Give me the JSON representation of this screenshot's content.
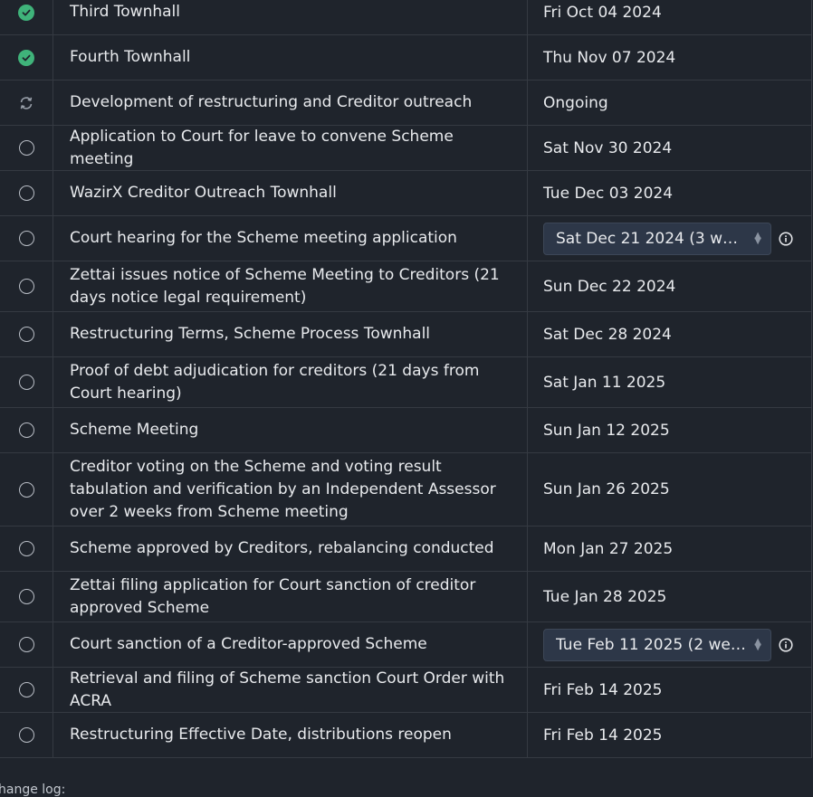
{
  "rows": [
    {
      "status": "done",
      "status_icon": "check-circle-icon",
      "task": "Third Townhall",
      "date": "Fri Oct 04 2024"
    },
    {
      "status": "done",
      "status_icon": "check-circle-icon",
      "task": "Fourth Townhall",
      "date": "Thu Nov 07 2024"
    },
    {
      "status": "ongoing",
      "status_icon": "sync-icon",
      "task": "Development of restructuring and Creditor outreach",
      "date": "Ongoing"
    },
    {
      "status": "todo",
      "status_icon": "empty-circle-icon",
      "task": "Application to Court for leave to convene Scheme meeting",
      "date": "Sat Nov 30 2024"
    },
    {
      "status": "todo",
      "status_icon": "empty-circle-icon",
      "task": "WazirX Creditor Outreach Townhall",
      "date": "Tue Dec 03 2024"
    },
    {
      "status": "todo",
      "status_icon": "empty-circle-icon",
      "task": "Court hearing for the Scheme meeting application",
      "date": "Sat Dec 21 2024 (3 wee...",
      "select": true
    },
    {
      "status": "todo",
      "status_icon": "empty-circle-icon",
      "task": "Zettai issues notice of Scheme Meeting to Creditors (21 days notice legal requirement)",
      "date": "Sun Dec 22 2024"
    },
    {
      "status": "todo",
      "status_icon": "empty-circle-icon",
      "task": "Restructuring Terms, Scheme Process Townhall",
      "date": "Sat Dec 28 2024"
    },
    {
      "status": "todo",
      "status_icon": "empty-circle-icon",
      "task": "Proof of debt adjudication for creditors (21 days from Court hearing)",
      "date": "Sat Jan 11 2025"
    },
    {
      "status": "todo",
      "status_icon": "empty-circle-icon",
      "task": "Scheme Meeting",
      "date": "Sun Jan 12 2025"
    },
    {
      "status": "todo",
      "status_icon": "empty-circle-icon",
      "task": "Creditor voting on the Scheme and voting result tabulation and verification by an Independent Assessor over 2 weeks from Scheme meeting",
      "date": "Sun Jan 26 2025"
    },
    {
      "status": "todo",
      "status_icon": "empty-circle-icon",
      "task": "Scheme approved by Creditors, rebalancing conducted",
      "date": "Mon Jan 27 2025"
    },
    {
      "status": "todo",
      "status_icon": "empty-circle-icon",
      "task": "Zettai filing application for Court sanction of creditor approved Scheme",
      "date": "Tue Jan 28 2025"
    },
    {
      "status": "todo",
      "status_icon": "empty-circle-icon",
      "task": "Court sanction of a Creditor-approved Scheme",
      "date": "Tue Feb 11 2025 (2 wee...",
      "select": true
    },
    {
      "status": "todo",
      "status_icon": "empty-circle-icon",
      "task": "Retrieval and filing of Scheme sanction Court Order with ACRA",
      "date": "Fri Feb 14 2025"
    },
    {
      "status": "todo",
      "status_icon": "empty-circle-icon",
      "task": "Restructuring Effective Date, distributions reopen",
      "date": "Fri Feb 14 2025"
    }
  ],
  "footer": {
    "label": "hange log:"
  },
  "colors": {
    "done": "#3fb37a",
    "background": "#1f242c",
    "select_bg": "#2d3748"
  }
}
